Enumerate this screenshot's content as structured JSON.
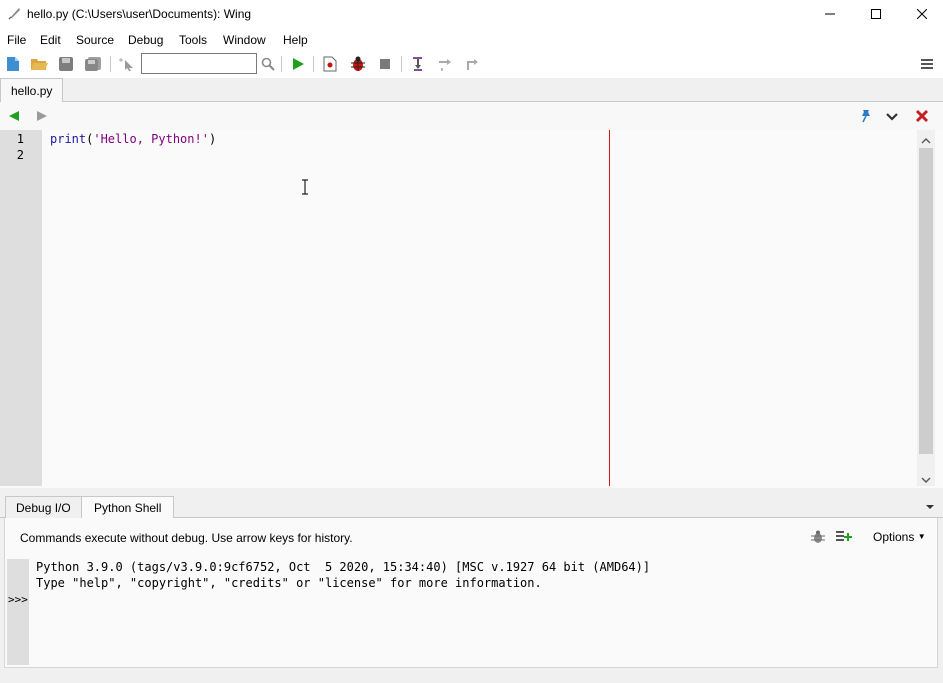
{
  "window": {
    "title": "hello.py (C:\\Users\\user\\Documents): Wing"
  },
  "menu": {
    "items": [
      "File",
      "Edit",
      "Source",
      "Debug",
      "Tools",
      "Window",
      "Help"
    ]
  },
  "toolbar": {
    "search_value": "",
    "icons": [
      "new-file-icon",
      "open-folder-icon",
      "save-icon",
      "save-all-icon",
      "select-pointer-icon",
      "search-icon",
      "run-icon",
      "breakpoint-file-icon",
      "debug-bug-icon",
      "stop-icon",
      "step-into-icon",
      "step-over-icon",
      "step-out-icon",
      "menu-icon"
    ]
  },
  "file_tabs": {
    "active": "hello.py"
  },
  "editor": {
    "line_numbers": [
      "1",
      "2"
    ],
    "code": {
      "func": "print",
      "open": "(",
      "string": "'Hello, Python!'",
      "close": ")"
    },
    "colors": {
      "keyword": "#1a1a9c",
      "string": "#7f007f",
      "edge_line": "#dd1111"
    }
  },
  "bottom_panel": {
    "tabs": [
      "Debug I/O",
      "Python Shell"
    ],
    "active_tab": "Python Shell",
    "hint": "Commands execute without debug.  Use arrow keys for history.",
    "options_label": "Options",
    "prompt": ">>>",
    "output": [
      "Python 3.9.0 (tags/v3.9.0:9cf6752, Oct  5 2020, 15:34:40) [MSC v.1927 64 bit (AMD64)]",
      "Type \"help\", \"copyright\", \"credits\" or \"license\" for more information."
    ]
  }
}
